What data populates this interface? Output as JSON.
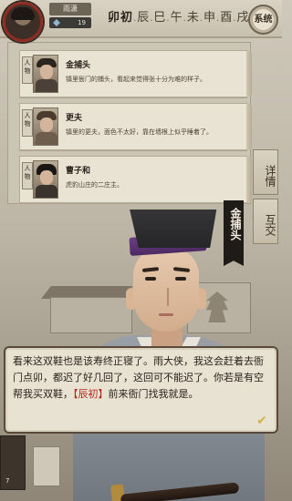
{
  "header": {
    "player_name": "雨潇",
    "player_stat": "19",
    "time_periods": [
      "卯初",
      "辰",
      "巳",
      "午",
      "未",
      "申",
      "酉",
      "戌"
    ],
    "system_label": "系统"
  },
  "people_panel": {
    "tag_label": "人物",
    "cards": [
      {
        "name": "金捕头",
        "desc": "镇里衙门的捕头，看起来觉得张十分为难的样子。"
      },
      {
        "name": "更夫",
        "desc": "镇里的更夫，面色不太好，靠在墙根上似乎睡着了。"
      },
      {
        "name": "曹子和",
        "desc": "虎豹山庄的二庄主。"
      }
    ]
  },
  "side_tabs": {
    "details": "详情",
    "interact": "互交"
  },
  "speaker": {
    "name": "金捕头"
  },
  "dialogue": {
    "text_before": "看来这双鞋也是该寿终正寝了。雨大侠，我这会赶着去衙门点卯，都迟了好几回了，这回可不能迟了。你若是有空帮我买双鞋，",
    "highlight": "【辰初】",
    "text_after": "前来衙门找我就是。",
    "continue_icon": "check-icon"
  },
  "bottom": {
    "count": "7"
  },
  "colors": {
    "highlight": "#b3261e",
    "hat_band": "#6b3f86",
    "avatar_ring": "#8e2b22"
  }
}
